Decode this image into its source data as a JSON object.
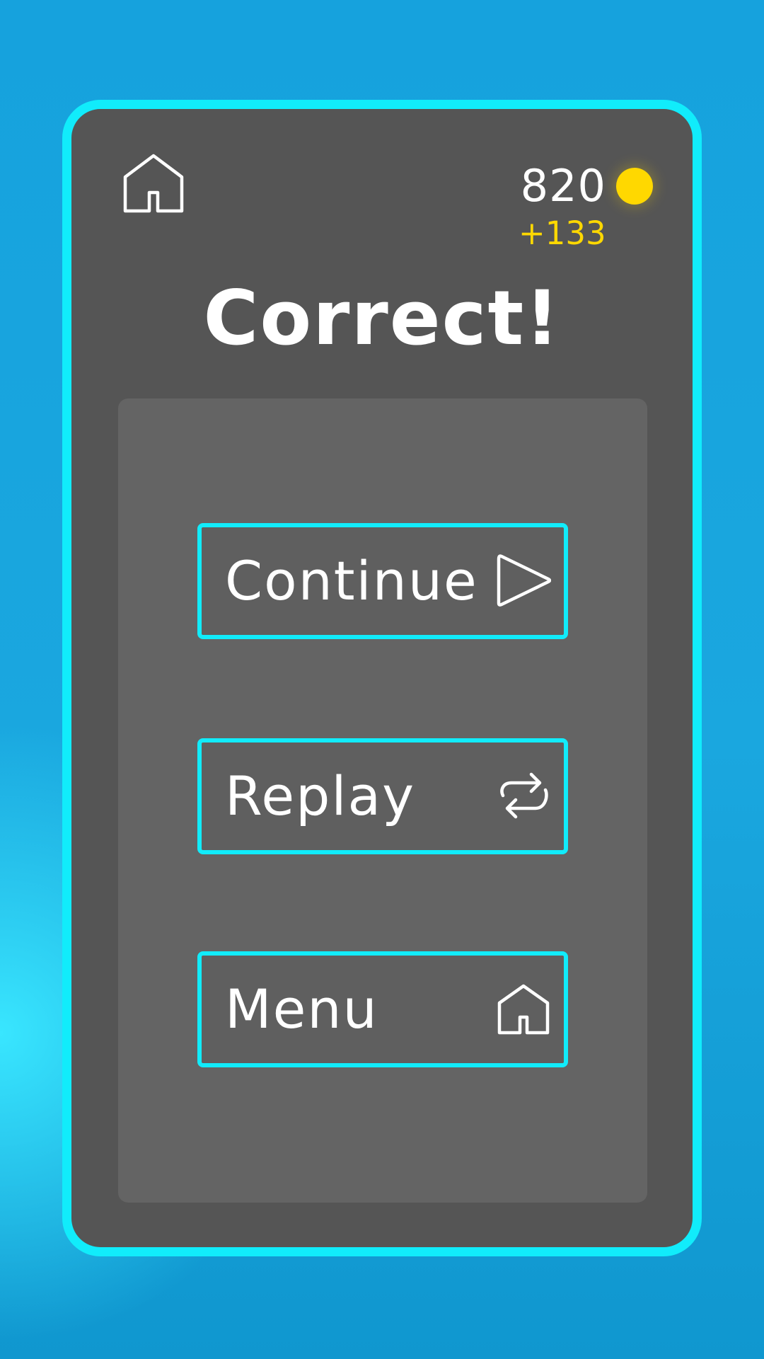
{
  "hud": {
    "coins": "820",
    "reward": "+133",
    "home_icon": "home-icon",
    "coin_icon": "coin-icon",
    "coin_color": "#ffd800"
  },
  "result": {
    "title": "Correct!"
  },
  "buttons": {
    "continue": {
      "label": "Continue",
      "icon": "play-icon"
    },
    "replay": {
      "label": "Replay",
      "icon": "replay-icon"
    },
    "menu": {
      "label": "Menu",
      "icon": "home-icon"
    }
  },
  "colors": {
    "accent": "#11ecfb",
    "card_bg": "#555555",
    "panel_bg": "#646464",
    "text": "#ffffff",
    "reward": "#ffd800"
  }
}
